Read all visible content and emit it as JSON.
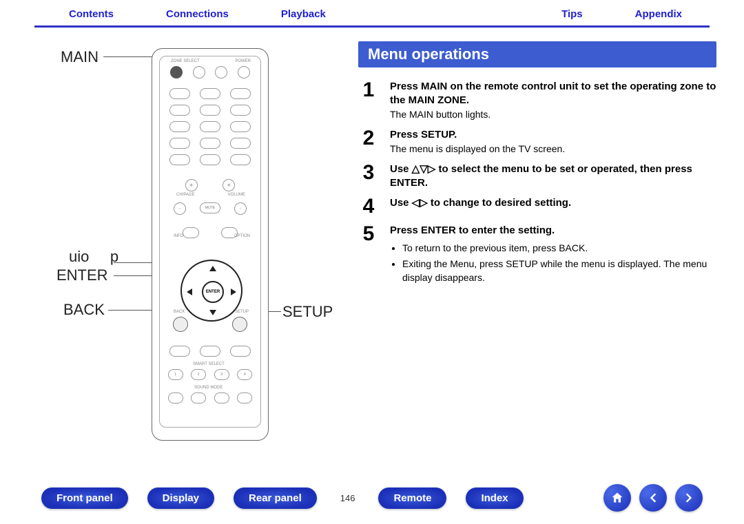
{
  "topnav": {
    "left": [
      "Contents",
      "Connections",
      "Playback"
    ],
    "right": [
      "Tips",
      "Appendix"
    ]
  },
  "remote_labels": {
    "main": "MAIN",
    "uio_p": "uio     p",
    "enter": "ENTER",
    "back": "BACK",
    "setup": "SETUP"
  },
  "heading": "Menu operations",
  "steps": [
    {
      "num": "1",
      "bold": "Press MAIN on the remote control unit to set the operating zone to the MAIN ZONE.",
      "sub": "The MAIN button lights."
    },
    {
      "num": "2",
      "bold": "Press SETUP.",
      "sub": "The menu is displayed on the TV screen."
    },
    {
      "num": "3",
      "bold": "Use △▽▷ to select the menu to be set or operated, then press ENTER."
    },
    {
      "num": "4",
      "bold": "Use ◁▷ to change to desired setting."
    },
    {
      "num": "5",
      "bold": "Press ENTER to enter the setting.",
      "bullets": [
        "To return to the previous item, press BACK.",
        "Exiting the Menu, press SETUP while the menu is displayed. The menu display disappears."
      ]
    }
  ],
  "page_number": "146",
  "bottomnav": [
    "Front panel",
    "Display",
    "Rear panel",
    "Remote",
    "Index"
  ],
  "icons": {
    "home": "home-icon",
    "prev": "arrow-left-icon",
    "next": "arrow-right-icon"
  }
}
